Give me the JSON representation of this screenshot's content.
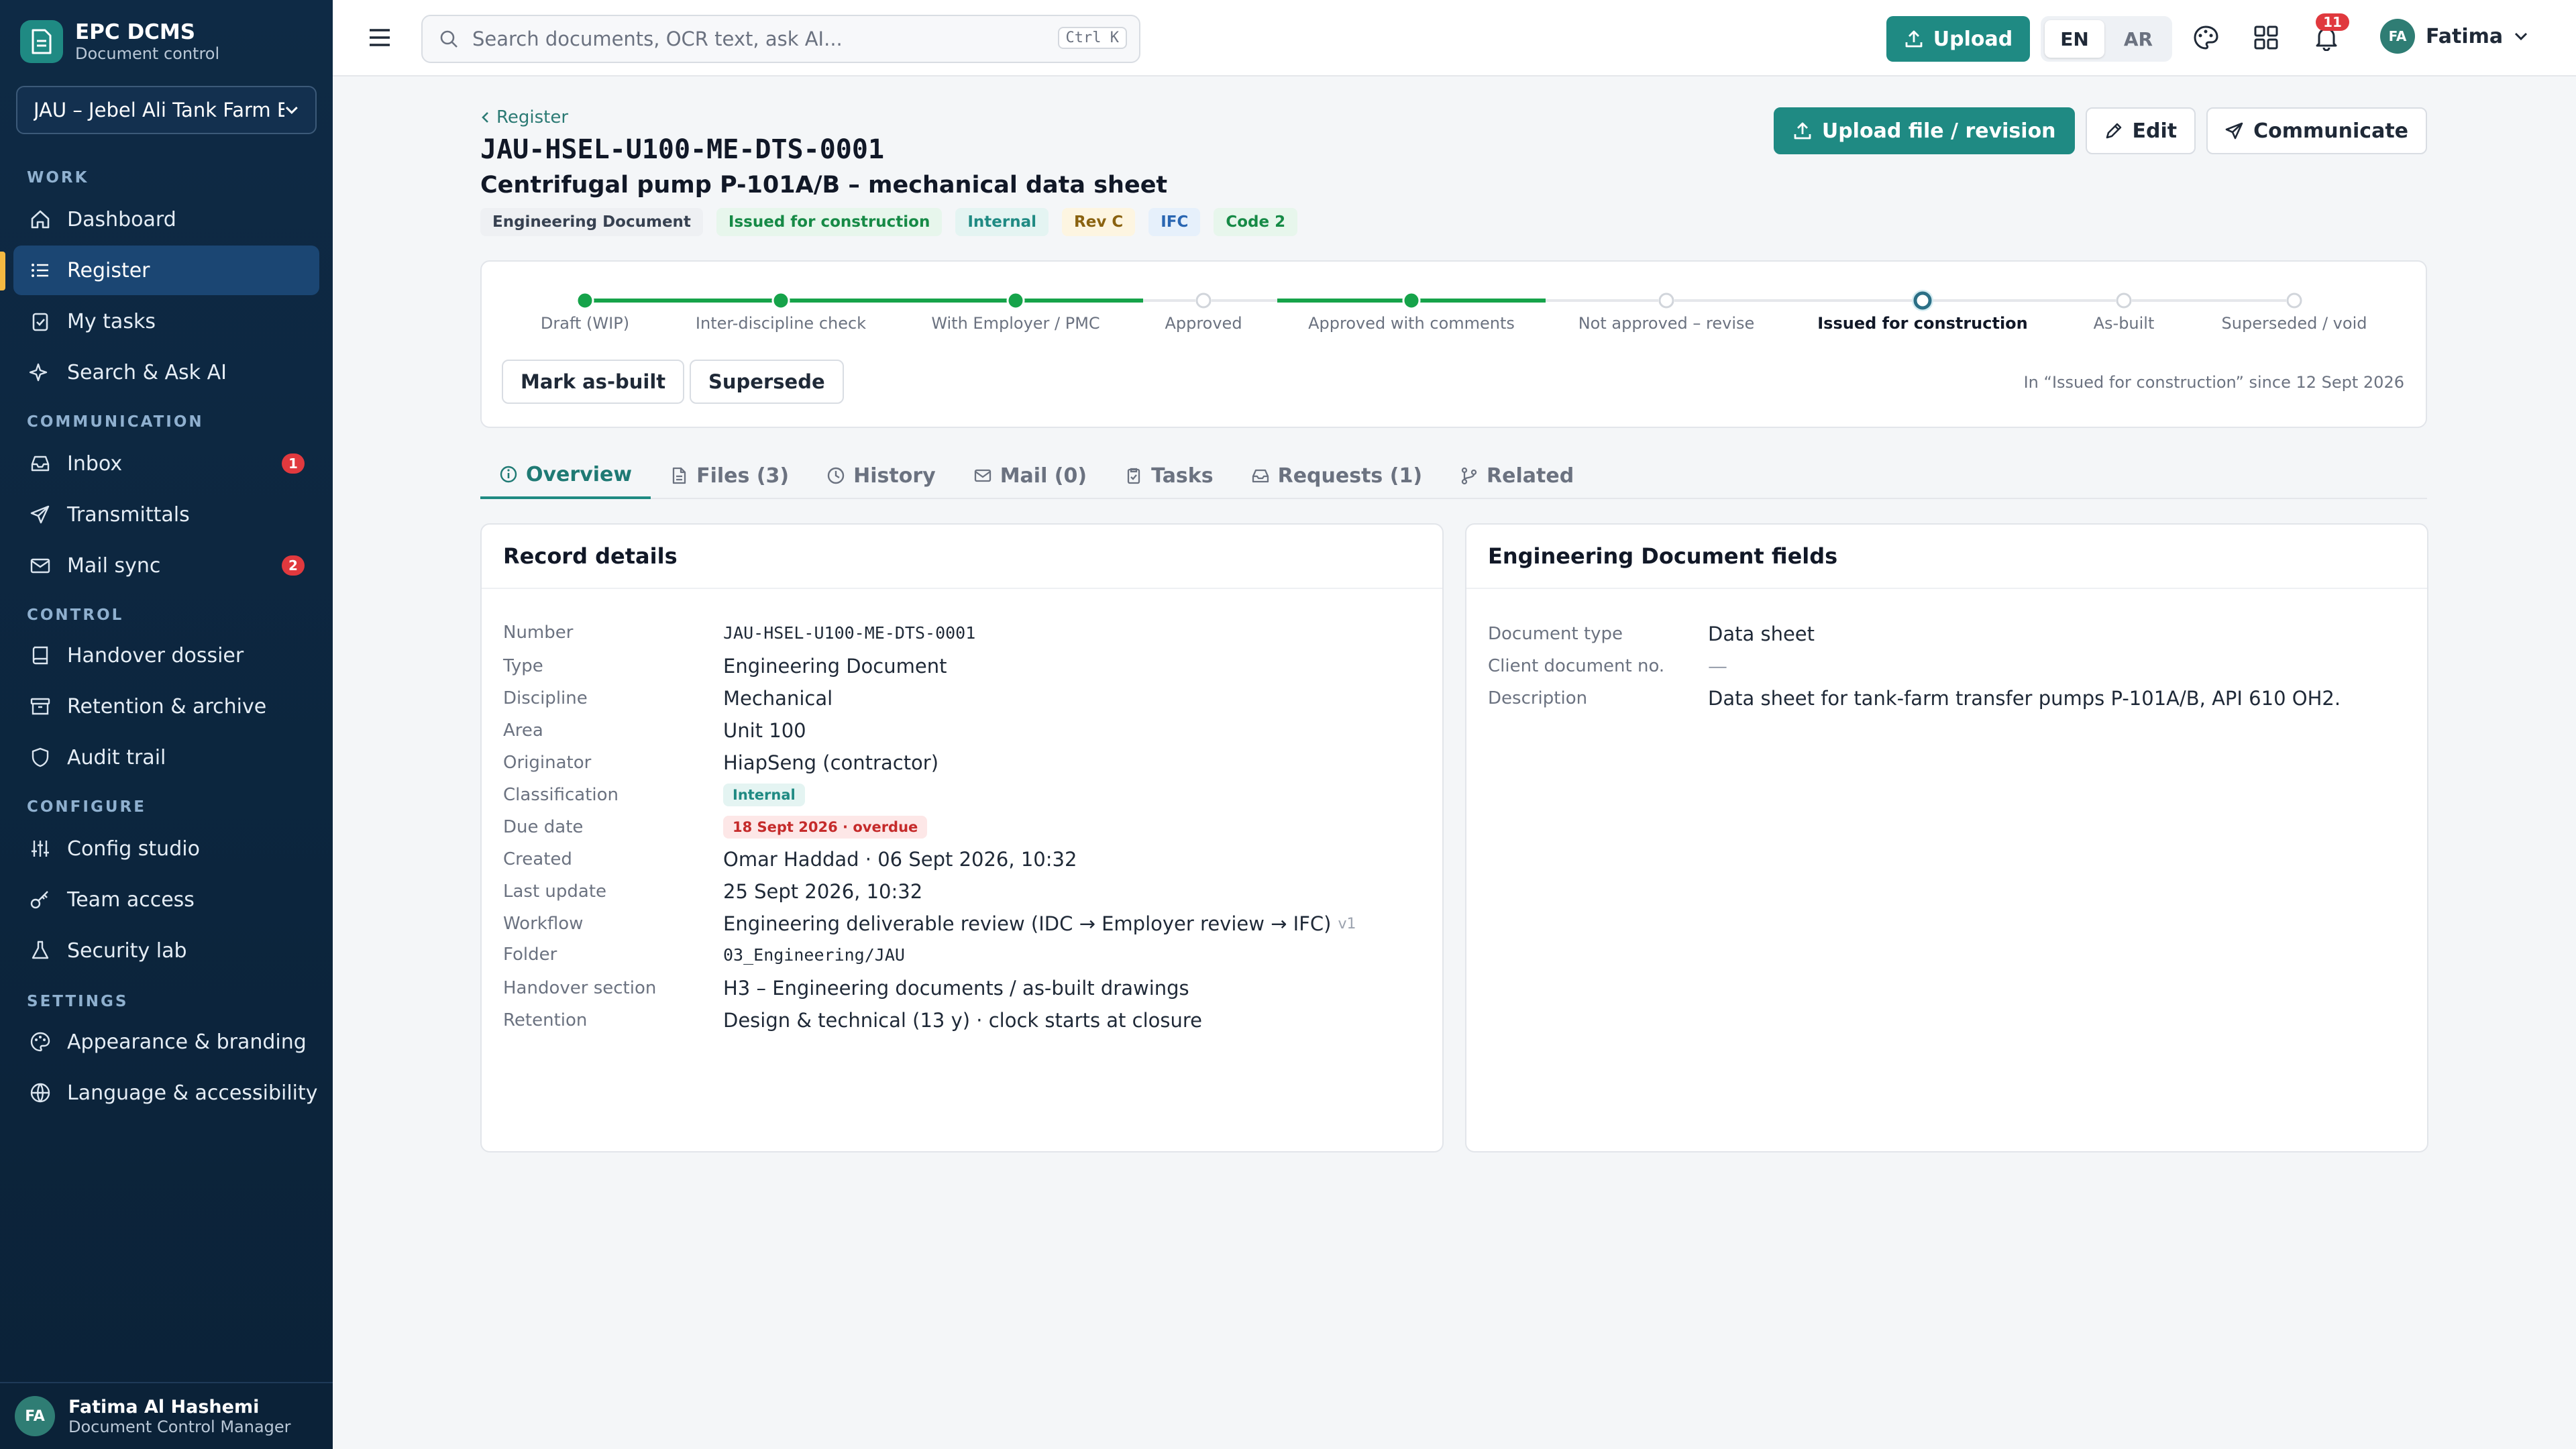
{
  "app": {
    "title": "EPC DCMS",
    "subtitle": "Document control"
  },
  "project_select": {
    "value": "JAU – Jebel Ali Tank Farm E"
  },
  "sidebar": {
    "sections": [
      "WORK",
      "COMMUNICATION",
      "CONTROL",
      "CONFIGURE",
      "SETTINGS"
    ],
    "items": [
      {
        "label": "Dashboard",
        "icon": "home-icon"
      },
      {
        "label": "Register",
        "icon": "list-icon",
        "active": true
      },
      {
        "label": "My tasks",
        "icon": "clipboard-icon"
      },
      {
        "label": "Search & Ask AI",
        "icon": "sparkle-icon"
      },
      {
        "label": "Inbox",
        "icon": "inbox-icon",
        "badge": "1"
      },
      {
        "label": "Transmittals",
        "icon": "send-icon"
      },
      {
        "label": "Mail sync",
        "icon": "mail-icon",
        "badge": "2"
      },
      {
        "label": "Handover dossier",
        "icon": "book-icon"
      },
      {
        "label": "Retention & archive",
        "icon": "archive-icon"
      },
      {
        "label": "Audit trail",
        "icon": "shield-icon"
      },
      {
        "label": "Config studio",
        "icon": "sliders-icon"
      },
      {
        "label": "Team access",
        "icon": "key-icon"
      },
      {
        "label": "Security lab",
        "icon": "flask-icon"
      },
      {
        "label": "Appearance & branding",
        "icon": "palette-icon"
      },
      {
        "label": "Language & accessibility",
        "icon": "globe-icon"
      }
    ],
    "user": {
      "initials": "FA",
      "name": "Fatima Al Hashemi",
      "role": "Document Control Manager"
    }
  },
  "topbar": {
    "search_placeholder": "Search documents, OCR text, ask AI...",
    "search_shortcut": "Ctrl K",
    "upload_label": "Upload",
    "lang": [
      "EN",
      "AR"
    ],
    "notifications": "11",
    "user_initials": "FA",
    "user_name": "Fatima"
  },
  "doc": {
    "breadcrumb": "Register",
    "number": "JAU-HSEL-U100-ME-DTS-0001",
    "title": "Centrifugal pump P-101A/B – mechanical data sheet",
    "tags": [
      "Engineering Document",
      "Issued for construction",
      "Internal",
      "Rev C",
      "IFC",
      "Code 2"
    ],
    "actions": {
      "upload": "Upload file / revision",
      "edit": "Edit",
      "communicate": "Communicate"
    }
  },
  "workflow": {
    "steps": [
      {
        "label": "Draft (WIP)",
        "state": "done"
      },
      {
        "label": "Inter-discipline check",
        "state": "done"
      },
      {
        "label": "With Employer / PMC",
        "state": "done"
      },
      {
        "label": "Approved",
        "state": "todo"
      },
      {
        "label": "Approved with comments",
        "state": "done"
      },
      {
        "label": "Not approved – revise",
        "state": "todo"
      },
      {
        "label": "Issued for construction",
        "state": "current"
      },
      {
        "label": "As-built",
        "state": "todo"
      },
      {
        "label": "Superseded / void",
        "state": "todo"
      }
    ],
    "buttons": [
      "Mark as-built",
      "Supersede"
    ],
    "since": "In “Issued for construction” since 12 Sept 2026",
    "accent": "#16a34a"
  },
  "tabs": [
    {
      "label": "Overview",
      "icon": "info-icon"
    },
    {
      "label": "Files (3)",
      "icon": "file-icon"
    },
    {
      "label": "History",
      "icon": "clock-icon"
    },
    {
      "label": "Mail (0)",
      "icon": "mail-icon"
    },
    {
      "label": "Tasks",
      "icon": "clipboard-icon"
    },
    {
      "label": "Requests (1)",
      "icon": "inbox-icon"
    },
    {
      "label": "Related",
      "icon": "branch-icon"
    }
  ],
  "record": {
    "title": "Record details",
    "rows": [
      {
        "k": "Number",
        "v": "JAU-HSEL-U100-ME-DTS-0001"
      },
      {
        "k": "Type",
        "v": "Engineering Document"
      },
      {
        "k": "Discipline",
        "v": "Mechanical"
      },
      {
        "k": "Area",
        "v": "Unit 100"
      },
      {
        "k": "Originator",
        "v": "HiapSeng (contractor)"
      },
      {
        "k": "Classification",
        "v": "Internal"
      },
      {
        "k": "Due date",
        "v": "18 Sept 2026 · overdue"
      },
      {
        "k": "Created",
        "v": "Omar Haddad · 06 Sept 2026, 10:32"
      },
      {
        "k": "Last update",
        "v": "25 Sept 2026, 10:32"
      },
      {
        "k": "Workflow",
        "v": "Engineering deliverable review (IDC → Employer review → IFC)",
        "ver": "v1"
      },
      {
        "k": "Folder",
        "v": "03_Engineering/JAU"
      },
      {
        "k": "Handover section",
        "v": "H3 – Engineering documents / as-built drawings"
      },
      {
        "k": "Retention",
        "v": "Design & technical (13 y) · clock starts at closure"
      }
    ]
  },
  "fields": {
    "title": "Engineering Document fields",
    "rows": [
      {
        "k": "Document type",
        "v": "Data sheet"
      },
      {
        "k": "Client document no.",
        "v": "—"
      },
      {
        "k": "Description",
        "v": "Data sheet for tank-farm transfer pumps P-101A/B, API 610 OH2."
      }
    ]
  }
}
